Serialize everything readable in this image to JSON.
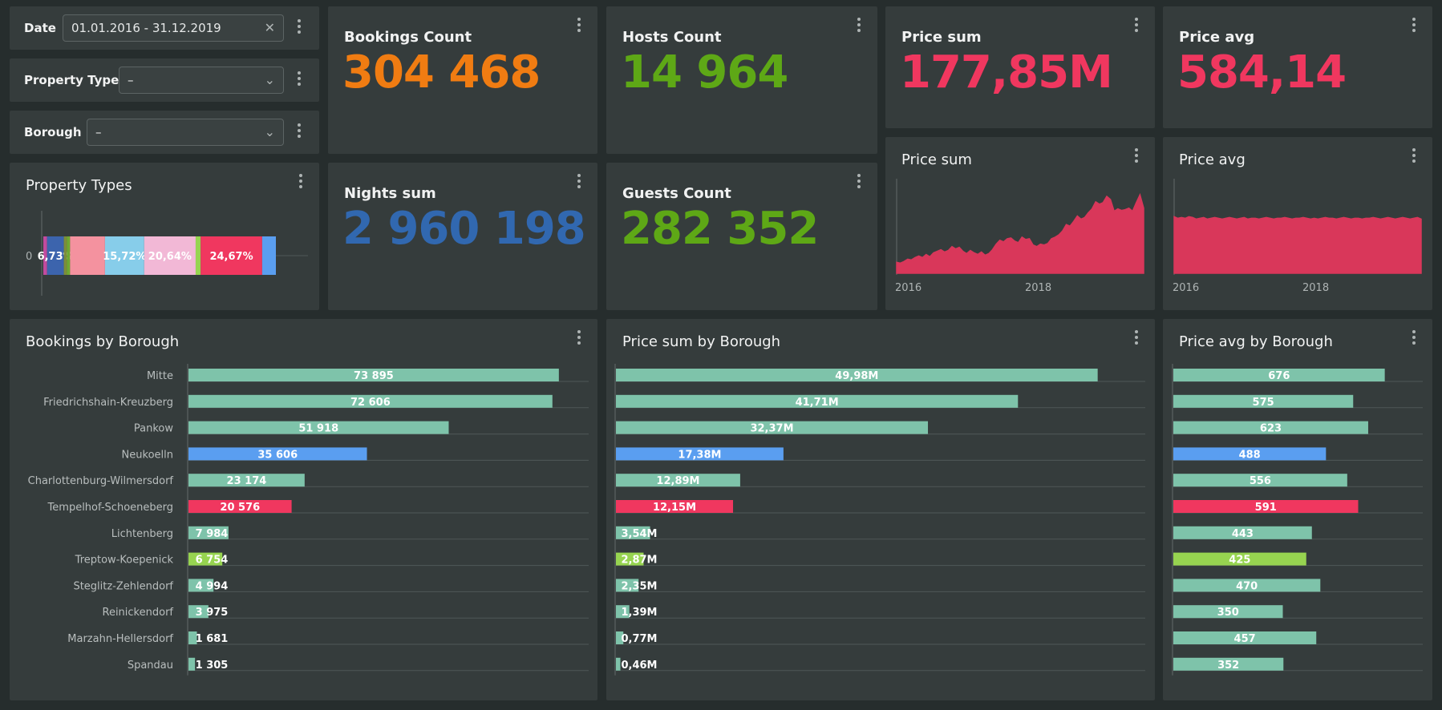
{
  "filters": {
    "date": {
      "label": "Date",
      "value": "01.01.2016 - 31.12.2019"
    },
    "property_type": {
      "label": "Property Type",
      "value": "–"
    },
    "borough": {
      "label": "Borough",
      "value": "–"
    }
  },
  "kpis": {
    "bookings": {
      "title": "Bookings Count",
      "value": "304 468",
      "color": "#f07c12"
    },
    "hosts": {
      "title": "Hosts Count",
      "value": "14 964",
      "color": "#5ea816"
    },
    "price_sum": {
      "title": "Price sum",
      "value": "177,85M",
      "color": "#f0375f"
    },
    "price_avg": {
      "title": "Price avg",
      "value": "584,14",
      "color": "#f0375f"
    },
    "nights": {
      "title": "Nights sum",
      "value": "2 960 198",
      "color": "#3168b0"
    },
    "guests": {
      "title": "Guests Count",
      "value": "282 352",
      "color": "#5ea816"
    }
  },
  "property_types": {
    "title": "Property Types",
    "axis_tick": "0",
    "segments": [
      {
        "share": 1.5,
        "color": "#c24b9e",
        "label": ""
      },
      {
        "share": 6.73,
        "color": "#3c64ad",
        "label": "6,73%"
      },
      {
        "share": 1.2,
        "color": "#7d8c3a",
        "label": ""
      },
      {
        "share": 1.3,
        "color": "#6fa832",
        "label": ""
      },
      {
        "share": 14.0,
        "color": "#f4929f",
        "label": ""
      },
      {
        "share": 15.72,
        "color": "#87cdea",
        "label": "15,72%"
      },
      {
        "share": 20.64,
        "color": "#f2b8d6",
        "label": "20,64%"
      },
      {
        "share": 2.0,
        "color": "#97d450",
        "label": ""
      },
      {
        "share": 24.67,
        "color": "#f0375f",
        "label": "24,67%"
      },
      {
        "share": 5.5,
        "color": "#5a9ef0",
        "label": ""
      }
    ]
  },
  "trend_sum": {
    "title": "Price sum",
    "x_labels": [
      "2016",
      "2018"
    ],
    "color": "#d9375a",
    "values": [
      14,
      13,
      15,
      18,
      17,
      20,
      22,
      20,
      24,
      21,
      26,
      28,
      30,
      27,
      29,
      34,
      31,
      33,
      28,
      25,
      29,
      26,
      24,
      27,
      23,
      25,
      30,
      37,
      42,
      40,
      44,
      45,
      41,
      39,
      46,
      43,
      44,
      36,
      34,
      37,
      36,
      38,
      44,
      46,
      49,
      54,
      62,
      60,
      66,
      73,
      69,
      71,
      77,
      82,
      91,
      88,
      90,
      98,
      94,
      79,
      82,
      80,
      81,
      83,
      79,
      90,
      100,
      83
    ]
  },
  "trend_avg": {
    "title": "Price avg",
    "x_labels": [
      "2016",
      "2018"
    ],
    "color": "#d9375a",
    "values": [
      72,
      70,
      71,
      70,
      72,
      71,
      69,
      70,
      71,
      69,
      70,
      71,
      70,
      69,
      70,
      71,
      70,
      69,
      70,
      71,
      69,
      70,
      70,
      69,
      70,
      71,
      70,
      69,
      70,
      70,
      71,
      70,
      69,
      70,
      70,
      71,
      70,
      69,
      70,
      69,
      70,
      71,
      70,
      70,
      69,
      70,
      71,
      70,
      69,
      70,
      70,
      69,
      70,
      70,
      71,
      70,
      69,
      70,
      71,
      70,
      69,
      70,
      71,
      70,
      69,
      70,
      71,
      69
    ]
  },
  "bookings_by_borough": {
    "title": "Bookings by Borough",
    "categories": [
      "Mitte",
      "Friedrichshain-Kreuzberg",
      "Pankow",
      "Neukoelln",
      "Charlottenburg-Wilmersdorf",
      "Tempelhof-Schoeneberg",
      "Lichtenberg",
      "Treptow-Koepenick",
      "Steglitz-Zehlendorf",
      "Reinickendorf",
      "Marzahn-Hellersdorf",
      "Spandau"
    ],
    "values": [
      73895,
      72606,
      51918,
      35606,
      23174,
      20576,
      7984,
      6754,
      4994,
      3975,
      1681,
      1305
    ],
    "labels": [
      "73 895",
      "72 606",
      "51 918",
      "35 606",
      "23 174",
      "20 576",
      "7 984",
      "6 754",
      "4 994",
      "3 975",
      "1 681",
      "1 305"
    ],
    "colors": [
      "#7ec3aa",
      "#7ec3aa",
      "#7ec3aa",
      "#5a9ef0",
      "#7ec3aa",
      "#f0375f",
      "#7ec3aa",
      "#97d450",
      "#7ec3aa",
      "#7ec3aa",
      "#7ec3aa",
      "#7ec3aa"
    ],
    "max": 80000
  },
  "price_sum_by_borough": {
    "title": "Price sum by Borough",
    "values": [
      49.98,
      41.71,
      32.37,
      17.38,
      12.89,
      12.15,
      3.54,
      2.87,
      2.35,
      1.39,
      0.77,
      0.46
    ],
    "labels": [
      "49,98M",
      "41,71M",
      "32,37M",
      "17,38M",
      "12,89M",
      "12,15M",
      "3,54M",
      "2,87M",
      "2,35M",
      "1,39M",
      "0,77M",
      "0,46M"
    ],
    "colors": [
      "#7ec3aa",
      "#7ec3aa",
      "#7ec3aa",
      "#5a9ef0",
      "#7ec3aa",
      "#f0375f",
      "#7ec3aa",
      "#97d450",
      "#7ec3aa",
      "#7ec3aa",
      "#7ec3aa",
      "#7ec3aa"
    ],
    "max": 55
  },
  "price_avg_by_borough": {
    "title": "Price avg by Borough",
    "values": [
      676,
      575,
      623,
      488,
      556,
      591,
      443,
      425,
      470,
      350,
      457,
      352
    ],
    "labels": [
      "676",
      "575",
      "623",
      "488",
      "556",
      "591",
      "443",
      "425",
      "470",
      "350",
      "457",
      "352"
    ],
    "colors": [
      "#7ec3aa",
      "#7ec3aa",
      "#7ec3aa",
      "#5a9ef0",
      "#7ec3aa",
      "#f0375f",
      "#7ec3aa",
      "#97d450",
      "#7ec3aa",
      "#7ec3aa",
      "#7ec3aa",
      "#7ec3aa"
    ],
    "max": 800
  }
}
